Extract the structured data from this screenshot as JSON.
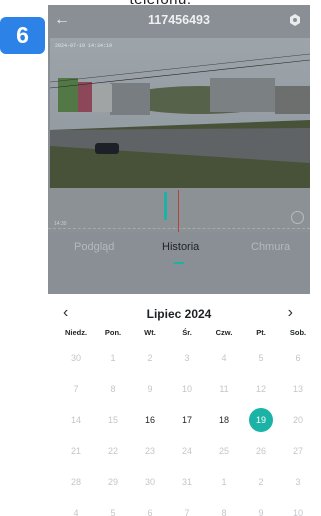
{
  "caption": "telefonu.",
  "step_badge": "6",
  "header": {
    "title": "117456493",
    "back_icon": "arrow-left-icon",
    "settings_icon": "gear-icon"
  },
  "video": {
    "timestamp": "2024-07-19 14:34:19"
  },
  "timeline": {
    "time_label": "14:30"
  },
  "tabs": [
    {
      "label": "Podgląd",
      "active": false
    },
    {
      "label": "Historia",
      "active": true
    },
    {
      "label": "Chmura",
      "active": false
    }
  ],
  "calendar": {
    "month_label": "Lipiec 2024",
    "weekdays": [
      "Niedz.",
      "Pon.",
      "Wt.",
      "Śr.",
      "Czw.",
      "Pt.",
      "Sob."
    ],
    "weeks": [
      [
        "30",
        "1",
        "2",
        "3",
        "4",
        "5",
        "6"
      ],
      [
        "7",
        "8",
        "9",
        "10",
        "11",
        "12",
        "13"
      ],
      [
        "14",
        "15",
        "16",
        "17",
        "18",
        "19",
        "20"
      ],
      [
        "21",
        "22",
        "23",
        "24",
        "25",
        "26",
        "27"
      ],
      [
        "28",
        "29",
        "30",
        "31",
        "1",
        "2",
        "3"
      ],
      [
        "4",
        "5",
        "6",
        "7",
        "8",
        "9",
        "10"
      ]
    ],
    "active_days": [
      "16",
      "17",
      "18"
    ],
    "selected_day": "19",
    "accent_color": "#1bb3a6"
  }
}
